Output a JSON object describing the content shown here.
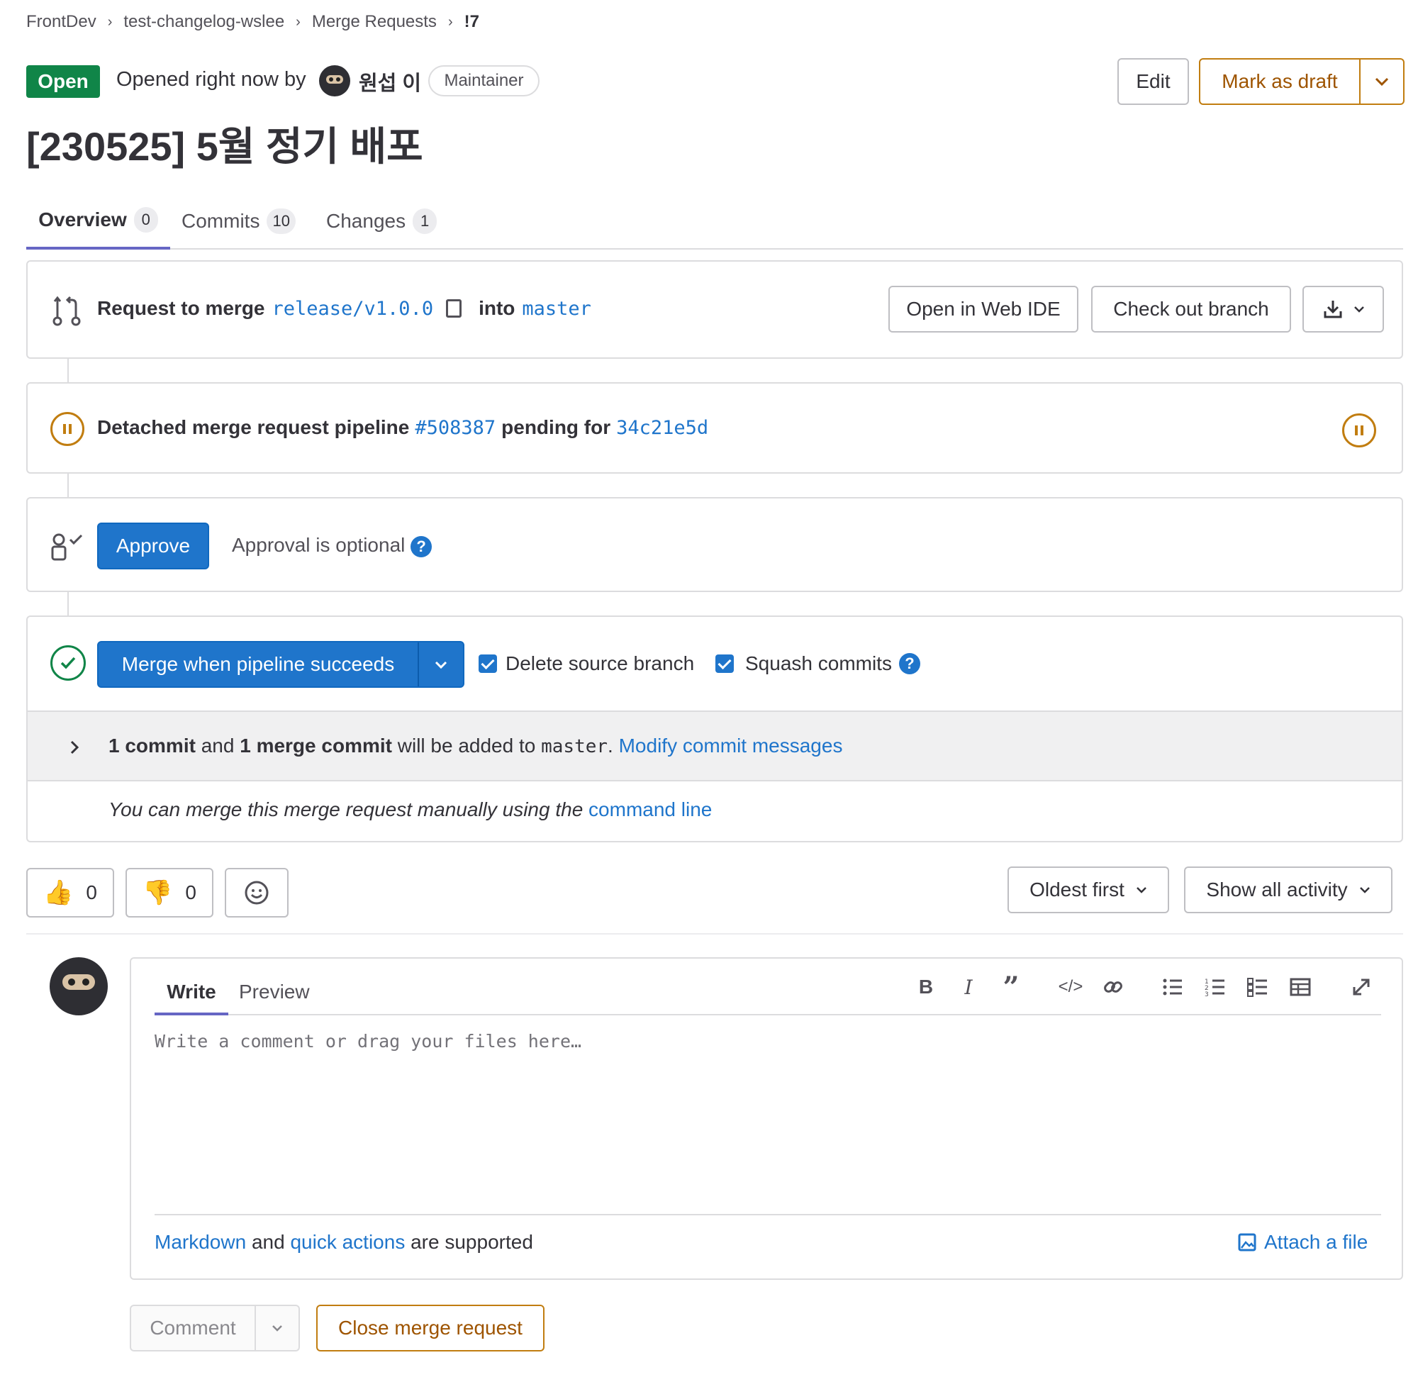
{
  "breadcrumb": {
    "items": [
      "FrontDev",
      "test-changelog-wslee",
      "Merge Requests",
      "!7"
    ]
  },
  "header": {
    "status": "Open",
    "opened_text": "Opened right now by",
    "author": "원섭 이",
    "role": "Maintainer",
    "edit_label": "Edit",
    "draft_label": "Mark as draft",
    "title": "[230525] 5월 정기 배포"
  },
  "tabs": [
    {
      "label": "Overview",
      "count": "0"
    },
    {
      "label": "Commits",
      "count": "10"
    },
    {
      "label": "Changes",
      "count": "1"
    }
  ],
  "merge_info": {
    "prefix": "Request to merge",
    "source": "release/v1.0.0",
    "into": "into",
    "target": "master",
    "web_ide_label": "Open in Web IDE",
    "checkout_label": "Check out branch"
  },
  "pipeline": {
    "text1": "Detached merge request pipeline",
    "id": "#508387",
    "text2": "pending for",
    "sha": "34c21e5d"
  },
  "approval": {
    "approve_label": "Approve",
    "optional_text": "Approval is optional"
  },
  "merge": {
    "button_label": "Merge when pipeline succeeds",
    "delete_label": "Delete source branch",
    "squash_label": "Squash commits",
    "commit_count": "1 commit",
    "and": "and",
    "merge_commit": "1 merge commit",
    "added_text": "will be added to",
    "target": "master",
    "period": ".",
    "modify_label": "Modify commit messages",
    "manual_text": "You can merge this merge request manually using the",
    "command_line": "command line"
  },
  "reactions": {
    "thumbs_up": "0",
    "thumbs_down": "0"
  },
  "sort": {
    "order_label": "Oldest first",
    "filter_label": "Show all activity"
  },
  "editor": {
    "write_tab": "Write",
    "preview_tab": "Preview",
    "placeholder": "Write a comment or drag your files here…",
    "markdown_link": "Markdown",
    "and": "and",
    "quick_actions_link": "quick actions",
    "supported_text": "are supported",
    "attach_label": "Attach a file"
  },
  "footer": {
    "comment_label": "Comment",
    "close_label": "Close merge request"
  },
  "colors": {
    "accent": "#1f75cb",
    "success": "#108548",
    "warning": "#c17d10",
    "border": "#dcdcde"
  }
}
